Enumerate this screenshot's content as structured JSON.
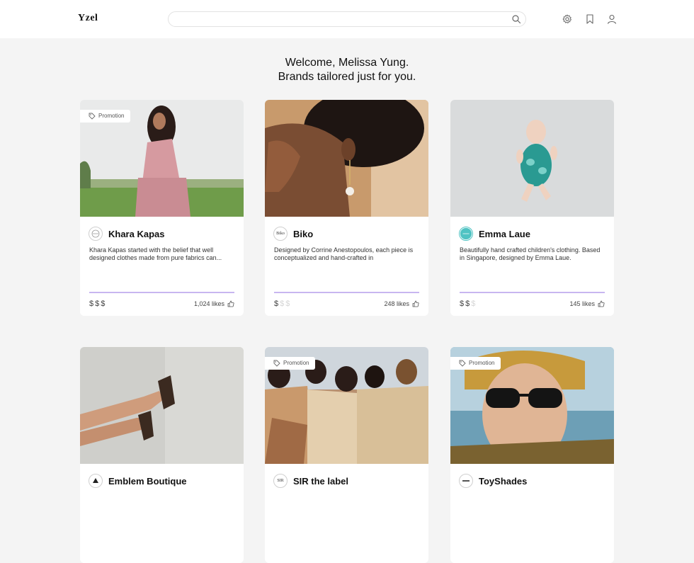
{
  "header": {
    "logo": "Yzel",
    "search_placeholder": "",
    "icons": [
      "search-icon",
      "gear-icon",
      "bookmark-icon",
      "user-icon"
    ]
  },
  "welcome": {
    "line1": "Welcome, Melissa Yung.",
    "line2": "Brands tailored just for you."
  },
  "colors": {
    "background": "#f4f4f4",
    "card": "#ffffff",
    "divider_accent": "#c8b6f0",
    "emma_logo": "#4fc3c3"
  },
  "cards": [
    {
      "name": "Khara Kapas",
      "promotion": "Promotion",
      "logo_text": "",
      "description": "Khara Kapas started with the belief that well designed clothes made from pure fabrics can...",
      "price_level": 3,
      "likes": "1,024 likes"
    },
    {
      "name": "Biko",
      "promotion": "",
      "logo_text": "Biko",
      "description": "Designed by Corrine Anestopoulos, each piece is conceptualized and hand-crafted in",
      "price_level": 1,
      "likes": "248 likes"
    },
    {
      "name": "Emma Laue",
      "promotion": "",
      "logo_text": "",
      "description": "Beautifully hand crafted children's clothing. Based in Singapore, designed by Emma Laue.",
      "price_level": 2,
      "likes": "145 likes"
    },
    {
      "name": "Emblem Boutique",
      "promotion": "",
      "logo_text": "",
      "description": "",
      "price_level": 0,
      "likes": ""
    },
    {
      "name": "SIR the label",
      "promotion": "Promotion",
      "logo_text": "SIR",
      "description": "",
      "price_level": 0,
      "likes": ""
    },
    {
      "name": "ToyShades",
      "promotion": "Promotion",
      "logo_text": "",
      "description": "",
      "price_level": 0,
      "likes": ""
    }
  ],
  "price_symbol": "$"
}
